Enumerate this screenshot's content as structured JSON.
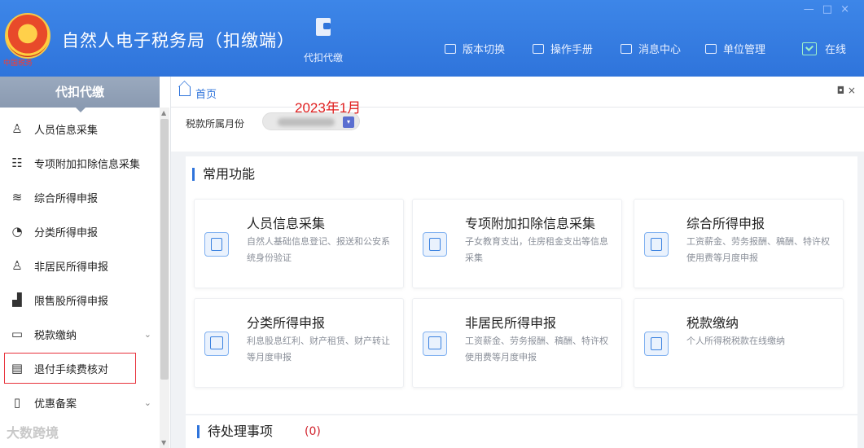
{
  "header": {
    "title": "自然人电子税务局（扣缴端）",
    "emblem_text": "中国税务",
    "active_tab": "代扣代缴",
    "menu": [
      {
        "label": "版本切换",
        "icon": "switch-icon"
      },
      {
        "label": "操作手册",
        "icon": "manual-icon"
      },
      {
        "label": "消息中心",
        "icon": "mail-icon"
      },
      {
        "label": "单位管理",
        "icon": "building-icon"
      },
      {
        "label": "在线",
        "icon": "online-check-icon"
      }
    ],
    "window_controls": [
      "—",
      "□",
      "×"
    ]
  },
  "sidebar": {
    "heading": "代扣代缴",
    "items": [
      {
        "label": "人员信息采集",
        "icon": "person-icon",
        "glyph": "♙"
      },
      {
        "label": "专项附加扣除信息采集",
        "icon": "list-icon",
        "glyph": "☷"
      },
      {
        "label": "综合所得申报",
        "icon": "layers-icon",
        "glyph": "≋"
      },
      {
        "label": "分类所得申报",
        "icon": "pie-icon",
        "glyph": "◔"
      },
      {
        "label": "非居民所得申报",
        "icon": "user-icon",
        "glyph": "♙"
      },
      {
        "label": "限售股所得申报",
        "icon": "bar-chart-icon",
        "glyph": "▟"
      },
      {
        "label": "税款缴纳",
        "icon": "folder-icon",
        "glyph": "▭",
        "expandable": true
      },
      {
        "label": "退付手续费核对",
        "icon": "document-icon",
        "glyph": "▤",
        "highlighted": true
      },
      {
        "label": "优惠备案",
        "icon": "file-icon",
        "glyph": "▯",
        "expandable": true
      }
    ]
  },
  "main": {
    "breadcrumb": "首页",
    "filter": {
      "label": "税款所属月份",
      "annotation": "2023年1月"
    },
    "common_section_title": "常用功能",
    "functions": [
      {
        "title": "人员信息采集",
        "desc": "自然人基础信息登记、报送和公安系统身份验证"
      },
      {
        "title": "专项附加扣除信息采集",
        "desc": "子女教育支出，住房租金支出等信息采集"
      },
      {
        "title": "综合所得申报",
        "desc": "工资薪金、劳务报酬、稿酬、特许权使用费等月度申报"
      },
      {
        "title": "分类所得申报",
        "desc": "利息股息红利、财产租赁、财产转让等月度申报"
      },
      {
        "title": "非居民所得申报",
        "desc": "工资薪金、劳务报酬、稿酬、特许权使用费等月度申报"
      },
      {
        "title": "税款缴纳",
        "desc": "个人所得税税款在线缴纳"
      }
    ],
    "pending_title": "待处理事项",
    "pending_count": "(0)"
  },
  "watermark": "大数跨境"
}
